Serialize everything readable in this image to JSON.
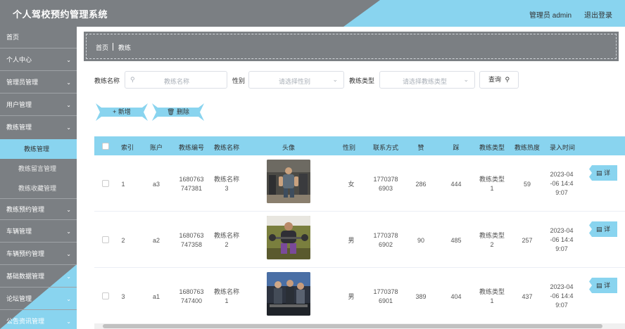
{
  "header": {
    "title": "个人驾校预约管理系统",
    "user": "管理员 admin",
    "logout": "退出登录"
  },
  "sidebar": {
    "items": [
      {
        "label": "首页",
        "chevron": ""
      },
      {
        "label": "个人中心",
        "chevron": "⌄"
      },
      {
        "label": "管理员管理",
        "chevron": "⌄"
      },
      {
        "label": "用户管理",
        "chevron": "⌄"
      },
      {
        "label": "教练管理",
        "chevron": "⌄"
      },
      {
        "label": "教练预约管理",
        "chevron": "⌄"
      },
      {
        "label": "车辆管理",
        "chevron": "⌄"
      },
      {
        "label": "车辆预约管理",
        "chevron": "⌄"
      },
      {
        "label": "基础数据管理",
        "chevron": "⌄"
      },
      {
        "label": "论坛管理",
        "chevron": "⌄"
      },
      {
        "label": "公告资讯管理",
        "chevron": "⌄"
      }
    ],
    "subitems": [
      "教练管理",
      "教练留言管理",
      "教练收藏管理"
    ]
  },
  "breadcrumb": {
    "home": "首页",
    "current": "教练"
  },
  "search": {
    "name_label": "教练名称",
    "name_placeholder": "教练名称",
    "gender_label": "性别",
    "gender_placeholder": "请选择性别",
    "type_label": "教练类型",
    "type_placeholder": "请选择教练类型",
    "query_button": "查询"
  },
  "actions": {
    "add": "新增",
    "delete": "删除"
  },
  "table": {
    "headers": [
      "索引",
      "账户",
      "教练编号",
      "教练名称",
      "头像",
      "性别",
      "联系方式",
      "赞",
      "踩",
      "教练类型",
      "教练热度",
      "录入时间"
    ],
    "rows": [
      {
        "index": "1",
        "account": "a3",
        "code_1": "1680763",
        "code_2": "747381",
        "name_1": "教练名称",
        "name_2": "3",
        "gender": "女",
        "phone_1": "1770378",
        "phone_2": "6903",
        "likes": "286",
        "dislikes": "444",
        "type_1": "教练类型",
        "type_2": "1",
        "heat": "59",
        "time_1": "2023-04",
        "time_2": "-06 14:4",
        "time_3": "9:07",
        "btn": "详"
      },
      {
        "index": "2",
        "account": "a2",
        "code_1": "1680763",
        "code_2": "747358",
        "name_1": "教练名称",
        "name_2": "2",
        "gender": "男",
        "phone_1": "1770378",
        "phone_2": "6902",
        "likes": "90",
        "dislikes": "485",
        "type_1": "教练类型",
        "type_2": "2",
        "heat": "257",
        "time_1": "2023-04",
        "time_2": "-06 14:4",
        "time_3": "9:07",
        "btn": "详"
      },
      {
        "index": "3",
        "account": "a1",
        "code_1": "1680763",
        "code_2": "747400",
        "name_1": "教练名称",
        "name_2": "1",
        "gender": "男",
        "phone_1": "1770378",
        "phone_2": "6901",
        "likes": "389",
        "dislikes": "404",
        "type_1": "教练类型",
        "type_2": "1",
        "heat": "437",
        "time_1": "2023-04",
        "time_2": "-06 14:4",
        "time_3": "9:07",
        "btn": "详"
      }
    ]
  },
  "colors": {
    "accent": "#89d4ef",
    "chrome": "#7b7f83"
  }
}
